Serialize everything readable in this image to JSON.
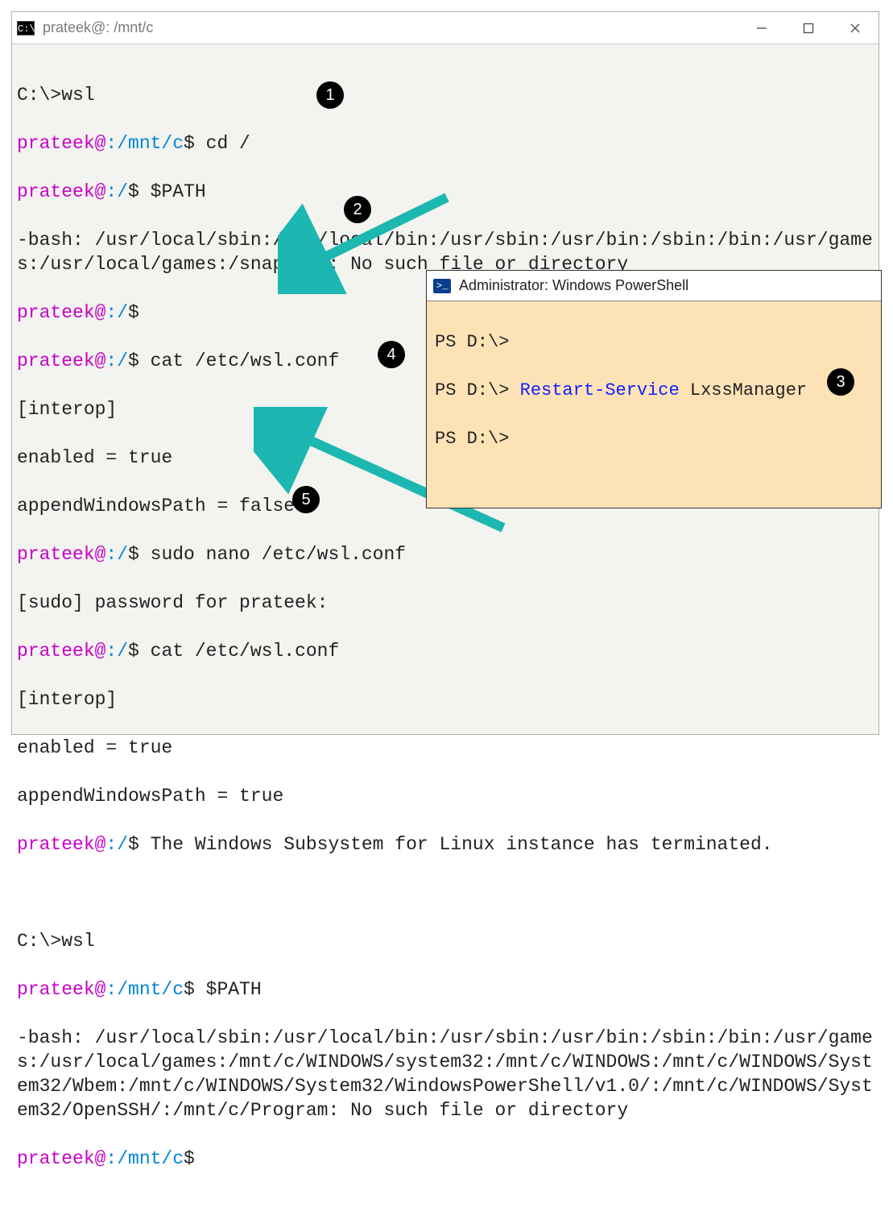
{
  "window": {
    "icon_text": "C:\\.",
    "title": "prateek@: /mnt/c"
  },
  "callouts": {
    "c1": "1",
    "c2": "2",
    "c3": "3",
    "c4": "4",
    "c5": "5"
  },
  "term": {
    "l01": "C:\\>wsl",
    "l02_user": "prateek@",
    "l02_path": ":/mnt/c",
    "l02_rest": "$ cd /",
    "l03_user": "prateek@",
    "l03_path": ":/",
    "l03_rest": "$ $PATH",
    "l04": "-bash: /usr/local/sbin:/usr/local/bin:/usr/sbin:/usr/bin:/sbin:/bin:/usr/games:/usr/local/games:/snap/bin: No such file or directory",
    "l05_user": "prateek@",
    "l05_path": ":/",
    "l05_rest": "$",
    "l06_user": "prateek@",
    "l06_path": ":/",
    "l06_rest": "$ cat /etc/wsl.conf",
    "l07": "[interop]",
    "l08": "enabled = true",
    "l09": "appendWindowsPath = false",
    "l10_user": "prateek@",
    "l10_path": ":/",
    "l10_rest": "$ sudo nano /etc/wsl.conf",
    "l11": "[sudo] password for prateek:",
    "l12_user": "prateek@",
    "l12_path": ":/",
    "l12_rest": "$ cat /etc/wsl.conf",
    "l13": "[interop]",
    "l14": "enabled = true",
    "l15": "appendWindowsPath = true",
    "l16_user": "prateek@",
    "l16_path": ":/",
    "l16_rest": "$ The Windows Subsystem for Linux instance has terminated.",
    "l17": " ",
    "l18": "C:\\>wsl",
    "l19_user": "prateek@",
    "l19_path": ":/mnt/c",
    "l19_rest": "$ $PATH",
    "l20": "-bash: /usr/local/sbin:/usr/local/bin:/usr/sbin:/usr/bin:/sbin:/bin:/usr/games:/usr/local/games:/mnt/c/WINDOWS/system32:/mnt/c/WINDOWS:/mnt/c/WINDOWS/System32/Wbem:/mnt/c/WINDOWS/System32/WindowsPowerShell/v1.0/:/mnt/c/WINDOWS/System32/OpenSSH/:/mnt/c/Program: No such file or directory",
    "l21_user": "prateek@",
    "l21_path": ":/mnt/c",
    "l21_rest": "$"
  },
  "ps": {
    "icon_text": ">_",
    "title": "Administrator: Windows PowerShell",
    "p1": "PS D:\\>",
    "p2_prompt": "PS D:\\> ",
    "p2_cmd": "Restart-Service",
    "p2_arg": " LxssManager",
    "p3": "PS D:\\>"
  }
}
